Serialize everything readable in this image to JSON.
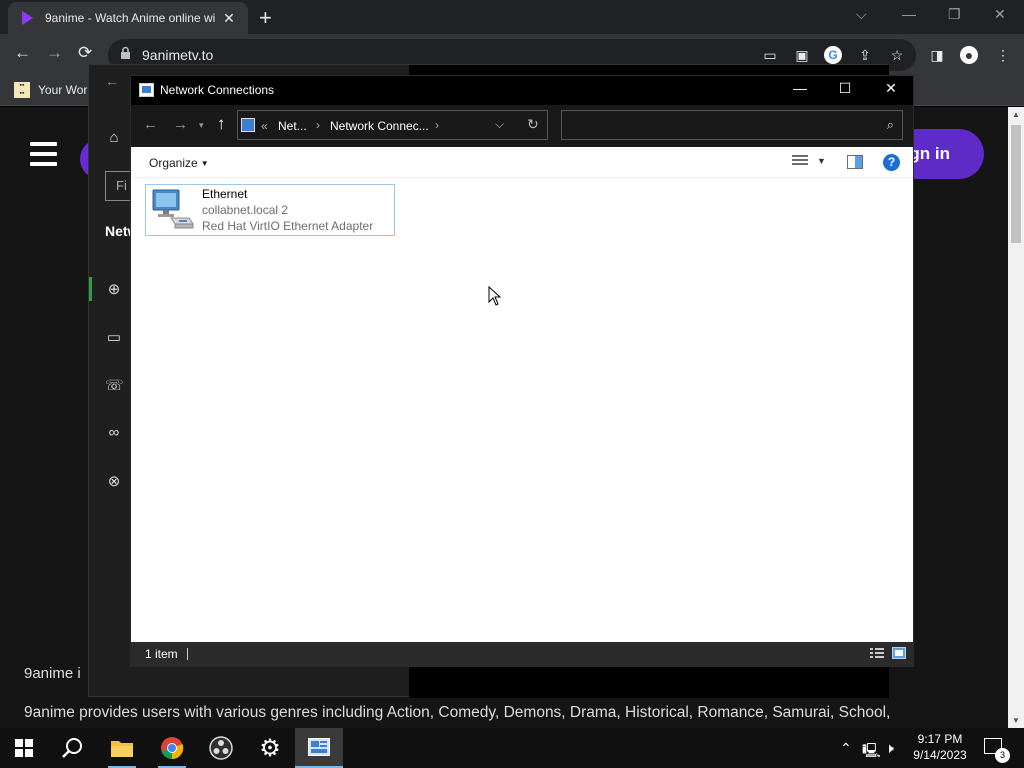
{
  "browser": {
    "tab_title": "9anime - Watch Anime online wi",
    "tab_close": "✕",
    "new_tab": "+",
    "url": "9animetv.to",
    "bookmark_label": "Your Wor",
    "window_controls": {
      "chevron": "⌵",
      "minimize": "—",
      "restore": "❐",
      "close": "✕"
    },
    "nav": {
      "back": "←",
      "forward": "→",
      "reload": "⟳"
    },
    "colors": {
      "tab_favicon": "#8b3dff",
      "signin_bg": "#5e2bc7"
    }
  },
  "site": {
    "signin_label": "gn in",
    "text_line1": "9anime i",
    "text_line2": "9anime provides users with various genres including Action, Comedy, Demons, Drama, Historical, Romance, Samurai, School,"
  },
  "settings_window": {
    "find_placeholder": "Fi",
    "section_label": "Netw"
  },
  "explorer": {
    "title": "Network Connections",
    "controls": {
      "minimize": "—",
      "maximize": "☐",
      "close": "✕"
    },
    "address": {
      "overflow": "«",
      "segments": [
        "Net...",
        "Network Connec..."
      ],
      "separator": "›"
    },
    "search_placeholder": "",
    "organize_label": "Organize",
    "help_label": "?",
    "items": [
      {
        "name": "Ethernet",
        "network": "collabnet.local 2",
        "adapter": "Red Hat VirtIO Ethernet Adapter"
      }
    ],
    "status_count": "1 item"
  },
  "taskbar": {
    "time": "9:17 PM",
    "date": "9/14/2023",
    "notification_count": "3",
    "pinned": [
      "start-icon",
      "search-icon",
      "file-explorer-icon",
      "chrome-icon",
      "obs-icon",
      "settings-icon",
      "network-connections-icon"
    ]
  }
}
